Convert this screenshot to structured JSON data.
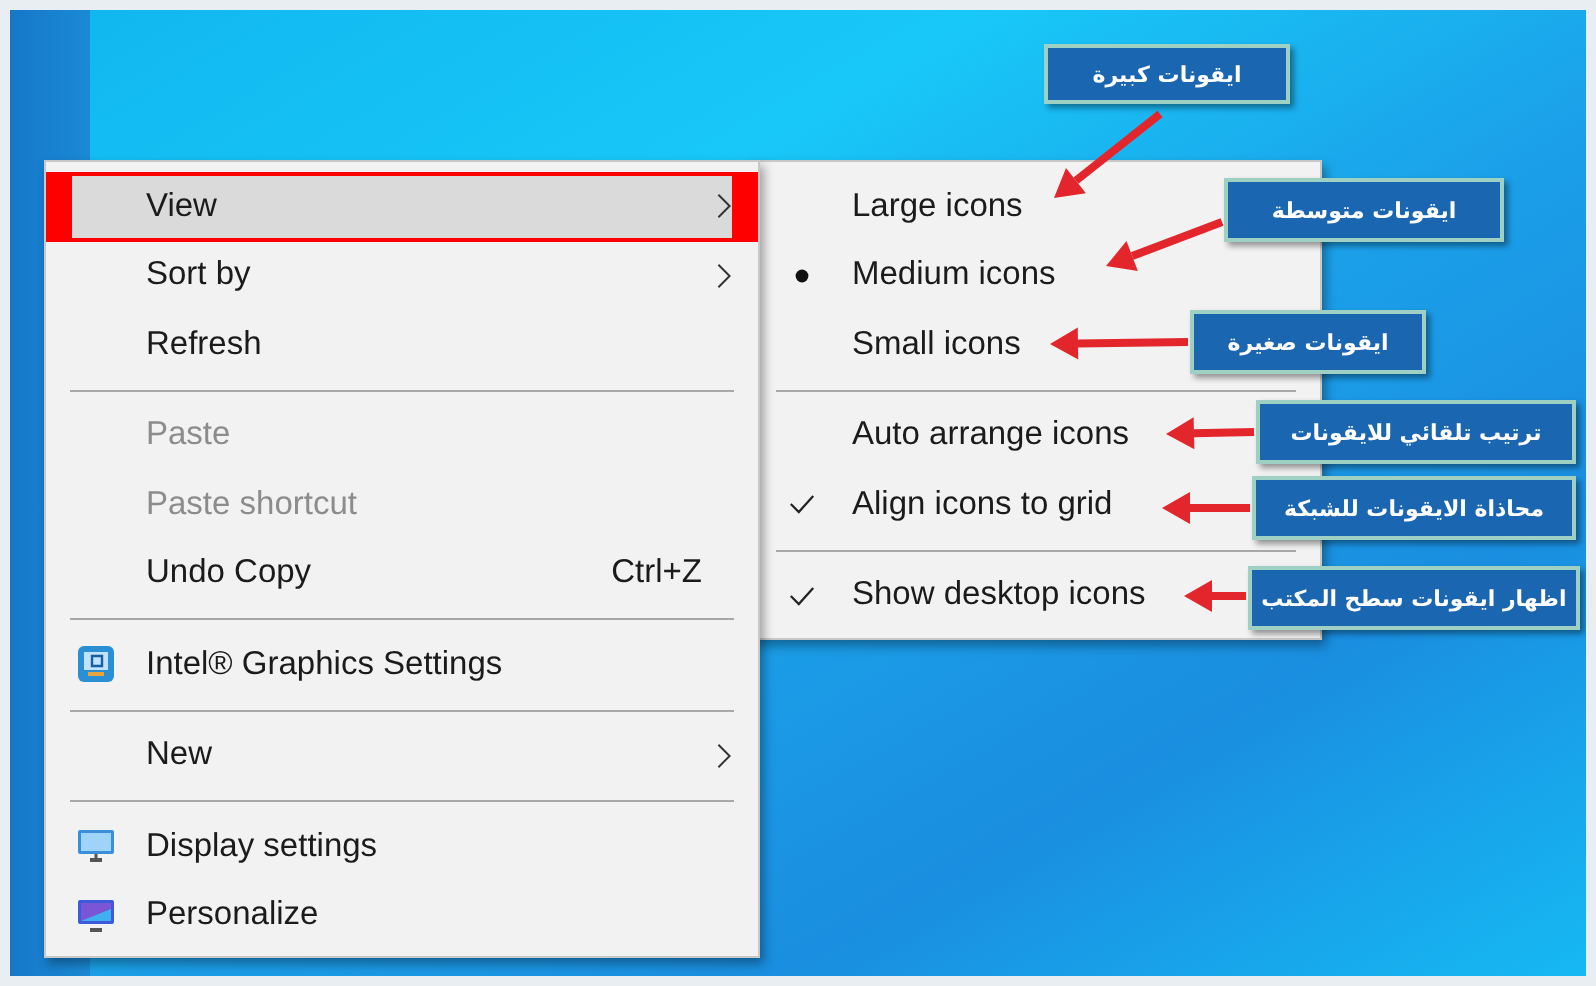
{
  "context_menu": {
    "items": [
      {
        "kind": "item",
        "label": "View",
        "submenu": true,
        "selected": true,
        "disabled": false
      },
      {
        "kind": "item",
        "label": "Sort by",
        "submenu": true,
        "selected": false,
        "disabled": false
      },
      {
        "kind": "item",
        "label": "Refresh",
        "submenu": false,
        "selected": false,
        "disabled": false
      },
      {
        "kind": "separator"
      },
      {
        "kind": "item",
        "label": "Paste",
        "submenu": false,
        "selected": false,
        "disabled": true
      },
      {
        "kind": "item",
        "label": "Paste shortcut",
        "submenu": false,
        "selected": false,
        "disabled": true
      },
      {
        "kind": "item",
        "label": "Undo Copy",
        "shortcut": "Ctrl+Z",
        "submenu": false,
        "selected": false,
        "disabled": false
      },
      {
        "kind": "separator"
      },
      {
        "kind": "graphics",
        "label": "Intel® Graphics Settings",
        "submenu": false,
        "selected": false,
        "disabled": false
      },
      {
        "kind": "separator"
      },
      {
        "kind": "item",
        "label": "New",
        "submenu": true,
        "selected": false,
        "disabled": false
      },
      {
        "kind": "separator"
      },
      {
        "kind": "display",
        "label": "Display settings",
        "submenu": false,
        "selected": false,
        "disabled": false
      },
      {
        "kind": "personalize",
        "label": "Personalize",
        "submenu": false,
        "selected": false,
        "disabled": false
      }
    ]
  },
  "view_submenu": {
    "items": [
      {
        "kind": "radio",
        "label": "Large icons",
        "checked": false
      },
      {
        "kind": "radio",
        "label": "Medium icons",
        "checked": true
      },
      {
        "kind": "radio",
        "label": "Small icons",
        "checked": false
      },
      {
        "kind": "separator"
      },
      {
        "kind": "check",
        "label": "Auto arrange icons",
        "checked": false
      },
      {
        "kind": "check",
        "label": "Align icons to grid",
        "checked": true
      },
      {
        "kind": "separator"
      },
      {
        "kind": "check",
        "label": "Show desktop icons",
        "checked": true
      }
    ]
  },
  "callouts": [
    {
      "text": "ايقونات كبيرة"
    },
    {
      "text": "ايقونات متوسطة"
    },
    {
      "text": "ايقونات صغيرة"
    },
    {
      "text": "ترتيب تلقائي للايقونات"
    },
    {
      "text": "محاذاة الايقونات للشبكة"
    },
    {
      "text": "اظهار ايقونات سطح المكتب"
    }
  ]
}
